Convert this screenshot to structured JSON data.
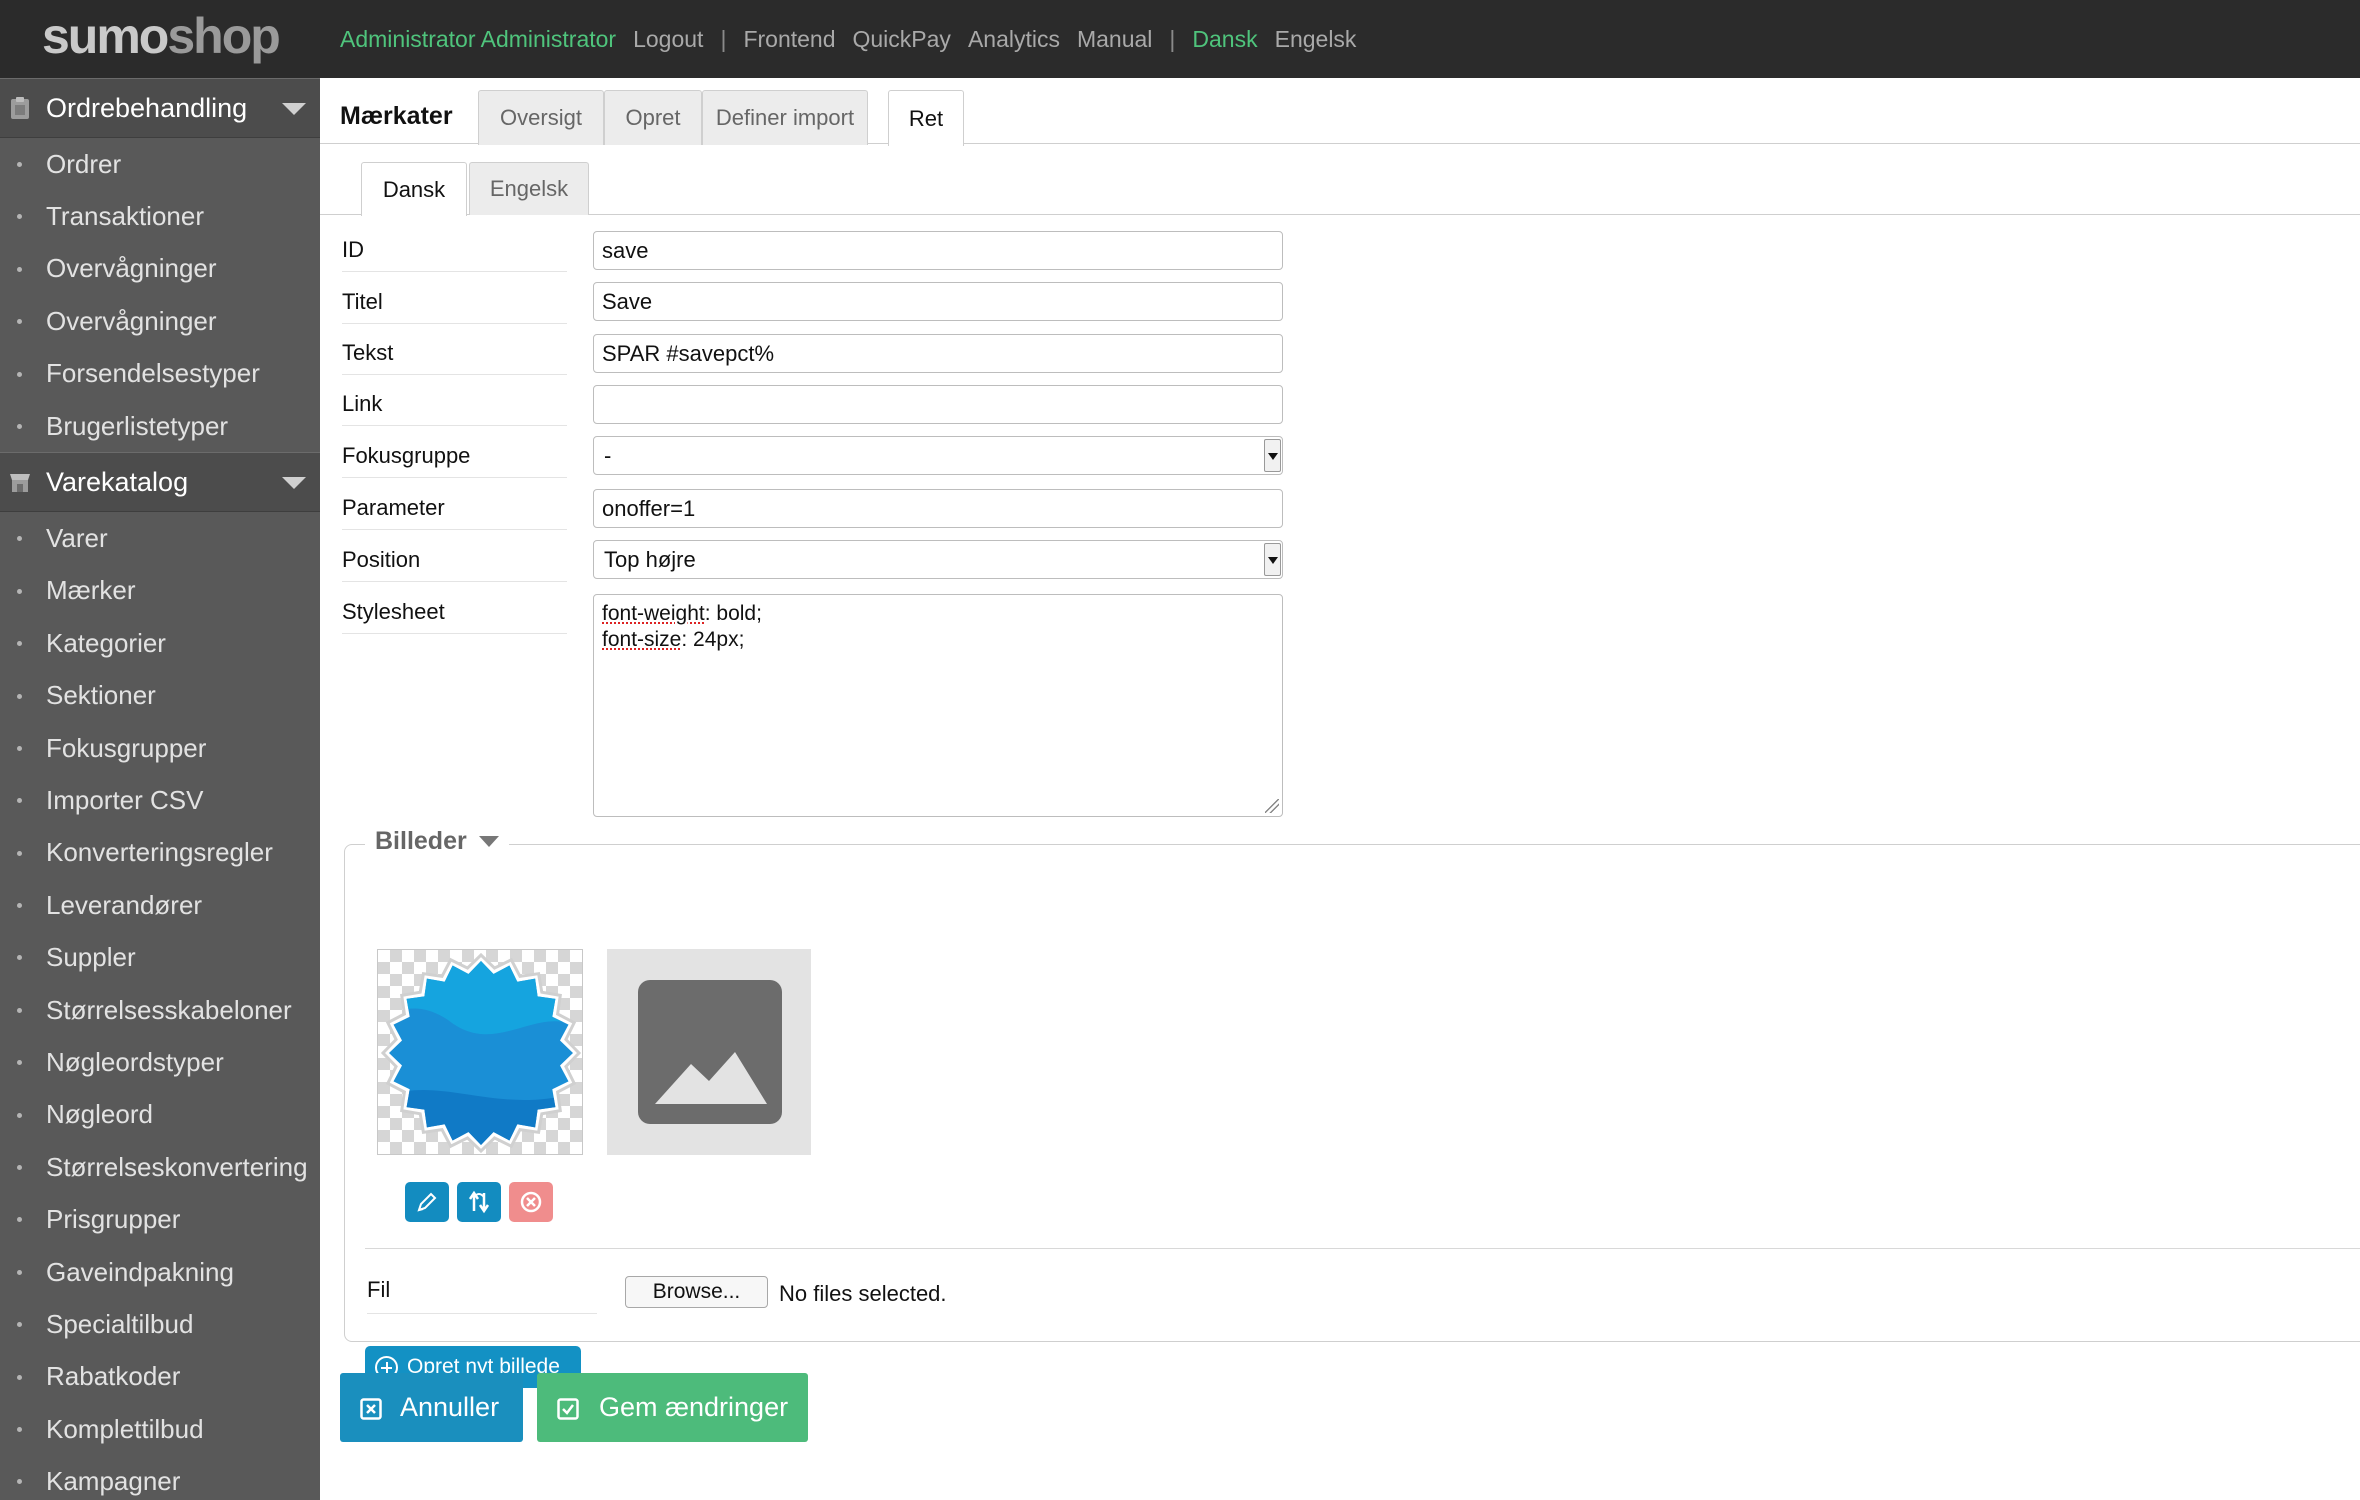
{
  "header": {
    "logo_part1": "sumo",
    "logo_part2": "shop",
    "user": "Administrator Administrator",
    "logout": "Logout",
    "sep1": "|",
    "frontend": "Frontend",
    "quickpay": "QuickPay",
    "analytics": "Analytics",
    "manual": "Manual",
    "sep2": "|",
    "lang_da": "Dansk",
    "lang_en": "Engelsk"
  },
  "sidebar": {
    "sections": [
      {
        "label": "Ordrebehandling",
        "items": [
          "Ordrer",
          "Transaktioner",
          "Overvågninger",
          "Overvågninger",
          "Forsendelsestyper",
          "Brugerlistetyper"
        ]
      },
      {
        "label": "Varekatalog",
        "items": [
          "Varer",
          "Mærker",
          "Kategorier",
          "Sektioner",
          "Fokusgrupper",
          "Importer CSV",
          "Konverteringsregler",
          "Leverandører",
          "Suppler",
          "Størrelsesskabeloner",
          "Nøgleordstyper",
          "Nøgleord",
          "Størrelseskonvertering",
          "Prisgrupper",
          "Gaveindpakning",
          "Specialtilbud",
          "Rabatkoder",
          "Komplettilbud",
          "Kampagner"
        ]
      }
    ]
  },
  "page": {
    "title": "Mærkater",
    "tabs": [
      "Oversigt",
      "Opret",
      "Definer import",
      "Ret"
    ],
    "lang_tabs": [
      "Dansk",
      "Engelsk"
    ]
  },
  "form": {
    "id_label": "ID",
    "id_value": "save",
    "titel_label": "Titel",
    "titel_value": "Save",
    "tekst_label": "Tekst",
    "tekst_value": "SPAR #savepct%",
    "link_label": "Link",
    "link_value": "",
    "fokus_label": "Fokusgruppe",
    "fokus_value": "-",
    "param_label": "Parameter",
    "param_value": "onoffer=1",
    "position_label": "Position",
    "position_value": "Top højre",
    "stylesheet_label": "Stylesheet",
    "stylesheet_l1_prop": "font-weight",
    "stylesheet_l1_val": ": bold;",
    "stylesheet_l2_prop": "font-size",
    "stylesheet_l2_val": ": 24px;"
  },
  "images": {
    "legend": "Billeder",
    "fil_label": "Fil",
    "browse": "Browse...",
    "no_files": "No files selected.",
    "new_image": "Opret nyt billede"
  },
  "actions": {
    "cancel": "Annuller",
    "save": "Gem ændringer"
  },
  "colors": {
    "topbar": "#2b2b2b",
    "sidebar": "#595959",
    "accent_green": "#4fc47c",
    "accent_blue": "#1391c4",
    "save_green": "#4dbb7b",
    "badge_blue": "#1a8fd6"
  }
}
